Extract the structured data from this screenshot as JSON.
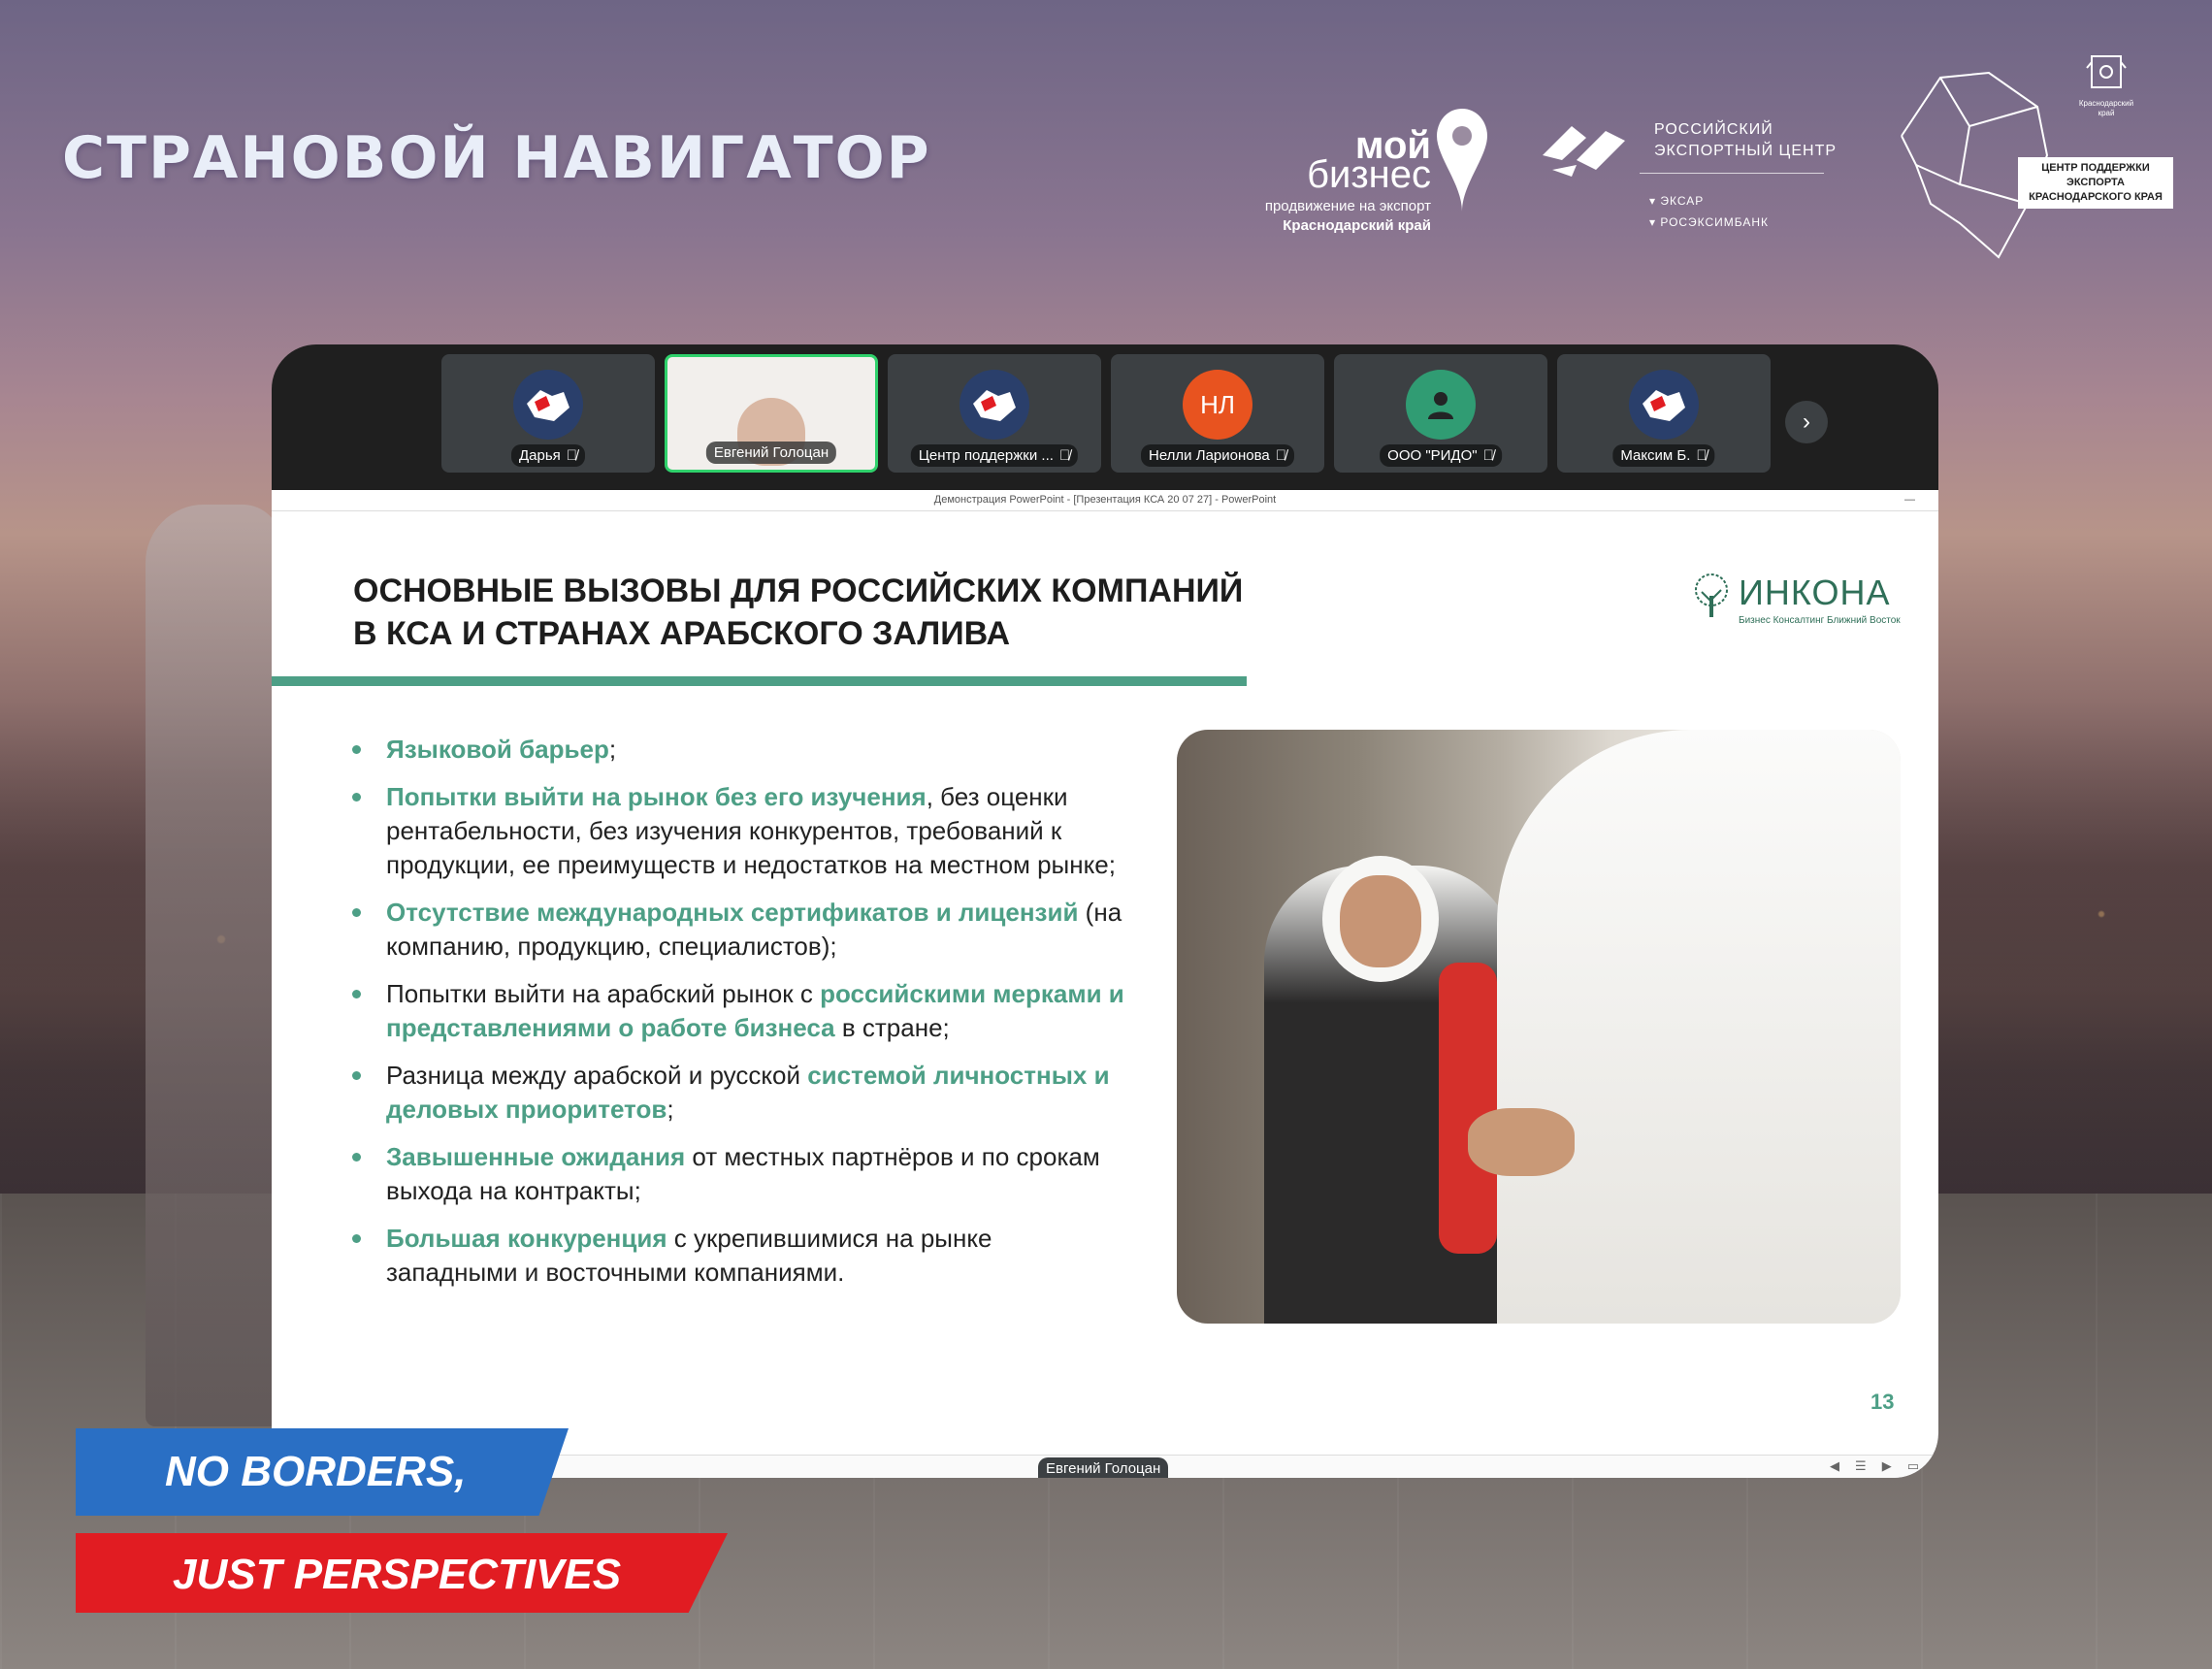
{
  "page": {
    "title": "СТРАНОВОЙ НАВИГАТОР"
  },
  "logos": {
    "moy_biznes": {
      "line1": "мой",
      "line2": "бизнес",
      "sub1": "продвижение на экспорт",
      "sub2": "Краснодарский край"
    },
    "rec": {
      "line1": "РОССИЙСКИЙ",
      "line2": "ЭКСПОРТНЫЙ ЦЕНТР",
      "sub1": "ЭКСАР",
      "sub2": "РОСЭКСИМБАНК"
    },
    "region": {
      "crest_label": "Краснодарский край",
      "box_line1": "ЦЕНТР ПОДДЕРЖКИ",
      "box_line2": "ЭКСПОРТА",
      "box_line3": "КРАСНОДАРСКОГО КРАЯ"
    }
  },
  "meeting": {
    "participants": [
      {
        "name": "Дарья",
        "avatar": "map-logo"
      },
      {
        "name": "Евгений Голоцан",
        "avatar": "video"
      },
      {
        "name": "Центр поддержки ...",
        "avatar": "map-logo"
      },
      {
        "name": "Нелли Ларионова",
        "avatar": "initials",
        "initials": "НЛ"
      },
      {
        "name": "ООО \"РИДО\"",
        "avatar": "person-icon"
      },
      {
        "name": "Максим Б.",
        "avatar": "map-logo"
      }
    ],
    "presenter": "Евгений Голоцан"
  },
  "slide": {
    "window_title": "Демонстрация PowerPoint - [Презентация КСА 20 07 27] - PowerPoint",
    "title_line1": "ОСНОВНЫЕ ВЫЗОВЫ ДЛЯ РОССИЙСКИХ КОМПАНИЙ",
    "title_line2": "В КСА И СТРАНАХ АРАБСКОГО ЗАЛИВА",
    "brand_name": "ИНКОНА",
    "brand_tagline": "Бизнес Консалтинг Ближний Восток",
    "bullets": [
      {
        "hl": "Языковой барьер",
        "rest": ";"
      },
      {
        "hl": "Попытки выйти на рынок без его изучения",
        "rest": ", без оценки рентабельности, без изучения конкурентов, требований к продукции, ее преимуществ и недостатков на местном рынке;"
      },
      {
        "hl": "Отсутствие международных сертификатов и лицензий",
        "rest": " (на компанию, продукцию, специалистов);"
      },
      {
        "pre": "Попытки выйти на арабский рынок с ",
        "hl": "российскими мерками и представлениями о работе бизнеса",
        "rest": " в стране;"
      },
      {
        "pre": "Разница между арабской и русской ",
        "hl": "системой личностных и деловых приоритетов",
        "rest": ";"
      },
      {
        "hl": "Завышенные ожидания",
        "rest": " от местных партнёров и по срокам выхода на контракты;"
      },
      {
        "hl": "Большая конкуренция",
        "rest": " с укрепившимися на рынке западными и восточными компаниями."
      }
    ],
    "slide_number": "13"
  },
  "ribbons": {
    "line1": "NO BORDERS,",
    "line2": "JUST PERSPECTIVES"
  },
  "colors": {
    "accent_green": "#4d9f86",
    "ribbon_blue": "#2a6fc4",
    "ribbon_red": "#e11c22",
    "active_speaker": "#2fd16b"
  }
}
